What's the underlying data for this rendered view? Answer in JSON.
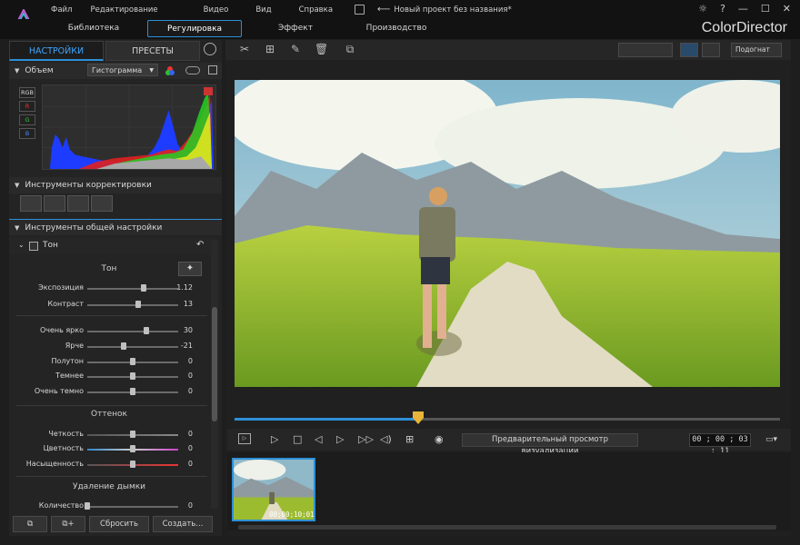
{
  "menu": {
    "file": "Файл",
    "edit": "Редактирование",
    "video": "Видео",
    "view": "Вид",
    "help": "Справка",
    "window_title": "Новый проект без названия*"
  },
  "window_controls": {
    "settings": "☼",
    "help": "?",
    "minimize": "—",
    "maximize": "☐",
    "close": "✕"
  },
  "main_tabs": {
    "library": "Библиотека",
    "adjust": "Регулировка",
    "effect": "Эффект",
    "produce": "Производство"
  },
  "brand": "ColorDirector",
  "panel_tabs": {
    "settings": "НАСТРОЙКИ",
    "presets": "ПРЕСЕТЫ"
  },
  "volume": {
    "label": "Объем",
    "mode": "Гистограмма"
  },
  "channels": [
    "RGB",
    "R",
    "G",
    "B"
  ],
  "correction_tools": "Инструменты корректировки",
  "general_tools": "Инструменты общей настройки",
  "tone_section": "Тон",
  "groups": {
    "tone": "Тон",
    "tint": "Оттенок",
    "dehaze": "Удаление дымки"
  },
  "sliders": [
    {
      "label": "Экспозиция",
      "value": "1.12",
      "pos": 0.62
    },
    {
      "label": "Контраст",
      "value": "13",
      "pos": 0.56
    },
    {
      "label": "Очень ярко",
      "value": "30",
      "pos": 0.65
    },
    {
      "label": "Ярче",
      "value": "-21",
      "pos": 0.4
    },
    {
      "label": "Полутон",
      "value": "0",
      "pos": 0.5
    },
    {
      "label": "Темнее",
      "value": "0",
      "pos": 0.5
    },
    {
      "label": "Очень темно",
      "value": "0",
      "pos": 0.5
    },
    {
      "label": "Четкость",
      "value": "0",
      "pos": 0.5
    },
    {
      "label": "Цветность",
      "value": "0",
      "pos": 0.5
    },
    {
      "label": "Насыщенность",
      "value": "0",
      "pos": 0.5
    },
    {
      "label": "Количество",
      "value": "0",
      "pos": 0.0
    }
  ],
  "bottom_buttons": {
    "reset": "Сбросить",
    "create": "Создать..."
  },
  "fit_dropdown": "Подогнат",
  "preview_render": "Предварительный просмотр визуализации",
  "timecode": "00 ; 00 ; 03 ; 11",
  "clip_timecode": "00;00;10;01",
  "colors": {
    "accent": "#2d8fd6",
    "playhead": "#e8b43a"
  }
}
